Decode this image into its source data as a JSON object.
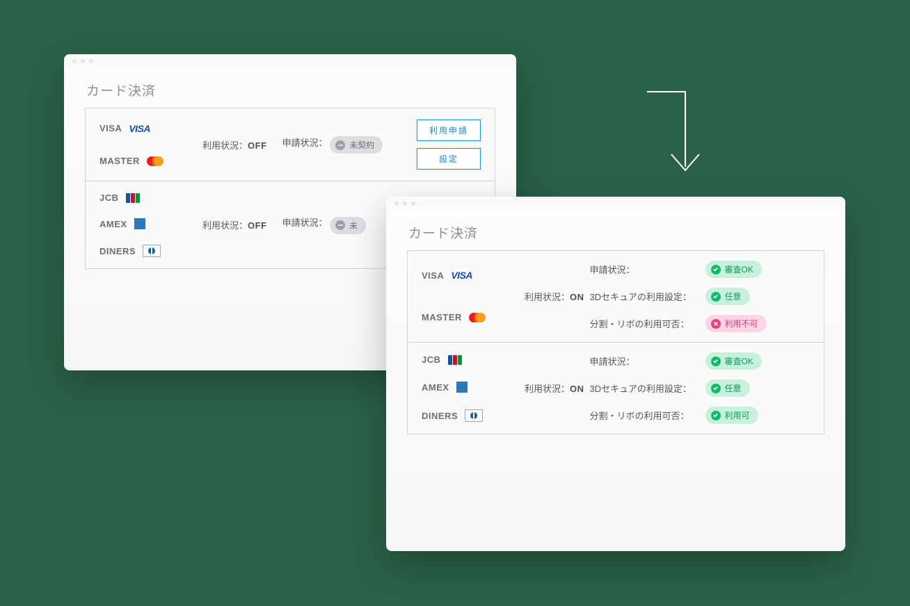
{
  "backWindow": {
    "title": "カード決済",
    "sections": [
      {
        "brands": [
          {
            "name": "VISA",
            "logo": "visa"
          },
          {
            "name": "MASTER",
            "logo": "mastercard"
          }
        ],
        "usageLabel": "利用状況：",
        "usageValue": "OFF",
        "applyStatusLabel": "申請状況：",
        "applyStatusValue": "未契約",
        "buttons": {
          "apply": "利用申請",
          "settings": "設定"
        }
      },
      {
        "brands": [
          {
            "name": "JCB",
            "logo": "jcb"
          },
          {
            "name": "AMEX",
            "logo": "amex"
          },
          {
            "name": "DINERS",
            "logo": "diners"
          }
        ],
        "usageLabel": "利用状況：",
        "usageValue": "OFF",
        "applyStatusLabel": "申請状況：",
        "applyStatusValue": "未"
      }
    ]
  },
  "frontWindow": {
    "title": "カード決済",
    "sections": [
      {
        "brands": [
          {
            "name": "VISA",
            "logo": "visa"
          },
          {
            "name": "MASTER",
            "logo": "mastercard"
          }
        ],
        "usageLabel": "利用状況：",
        "usageValue": "ON",
        "statuses": [
          {
            "label": "申請状況：",
            "pill": "審査OK",
            "kind": "green",
            "icon": "check"
          },
          {
            "label": "3Dセキュアの利用設定：",
            "pill": "任意",
            "kind": "green",
            "icon": "check"
          },
          {
            "label": "分割・リボの利用可否：",
            "pill": "利用不可",
            "kind": "pink",
            "icon": "cross"
          }
        ]
      },
      {
        "brands": [
          {
            "name": "JCB",
            "logo": "jcb"
          },
          {
            "name": "AMEX",
            "logo": "amex"
          },
          {
            "name": "DINERS",
            "logo": "diners"
          }
        ],
        "usageLabel": "利用状況：",
        "usageValue": "ON",
        "statuses": [
          {
            "label": "申請状況：",
            "pill": "審査OK",
            "kind": "green",
            "icon": "check"
          },
          {
            "label": "3Dセキュアの利用設定：",
            "pill": "任意",
            "kind": "green",
            "icon": "check"
          },
          {
            "label": "分割・リボの利用可否：",
            "pill": "利用可",
            "kind": "green",
            "icon": "check"
          }
        ]
      }
    ]
  }
}
